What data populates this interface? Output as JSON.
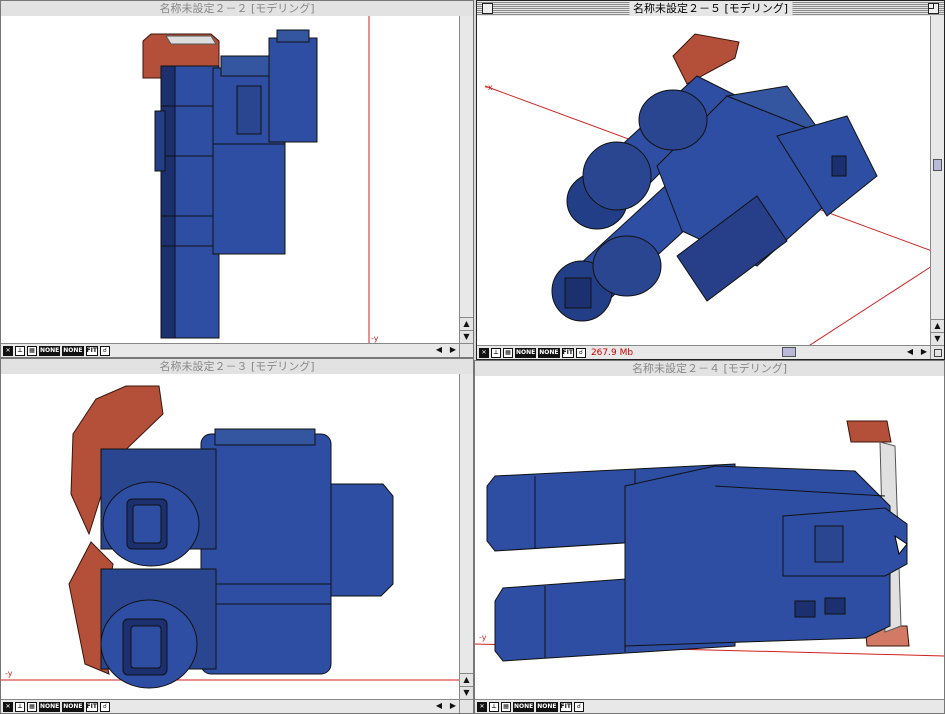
{
  "windows": {
    "top_left": {
      "title": "名称未設定２－２ [モデリング]",
      "axis_label": "-y",
      "active": false
    },
    "top_right": {
      "title": "名称未設定２－５ [モデリング]",
      "axis_label": "-x",
      "active": true,
      "memory": "267.9 Mb"
    },
    "bottom_left": {
      "title": "名称未設定２－３ [モデリング]",
      "axis_label": "-y",
      "active": false
    },
    "bottom_right": {
      "title": "名称未設定２－４ [モデリング]",
      "axis_label": "-y",
      "active": false
    }
  },
  "status_icons": {
    "icon_a": "✕",
    "none_1": "NONE",
    "none_2": "NONE",
    "fit": "FIT"
  },
  "colors": {
    "model_blue": "#2e4ea3",
    "model_blue_dark": "#1c2f6e",
    "model_orange": "#b45039",
    "axis_red": "#d02020",
    "accent_memory": "#d00000"
  },
  "icons": [
    "close-box-icon",
    "zoom-box-icon",
    "axis-icon",
    "grid-icon",
    "hand-icon",
    "scroll-up-arrow-icon",
    "scroll-down-arrow-icon",
    "scroll-left-arrow-icon",
    "scroll-right-arrow-icon",
    "grow-box-icon"
  ]
}
